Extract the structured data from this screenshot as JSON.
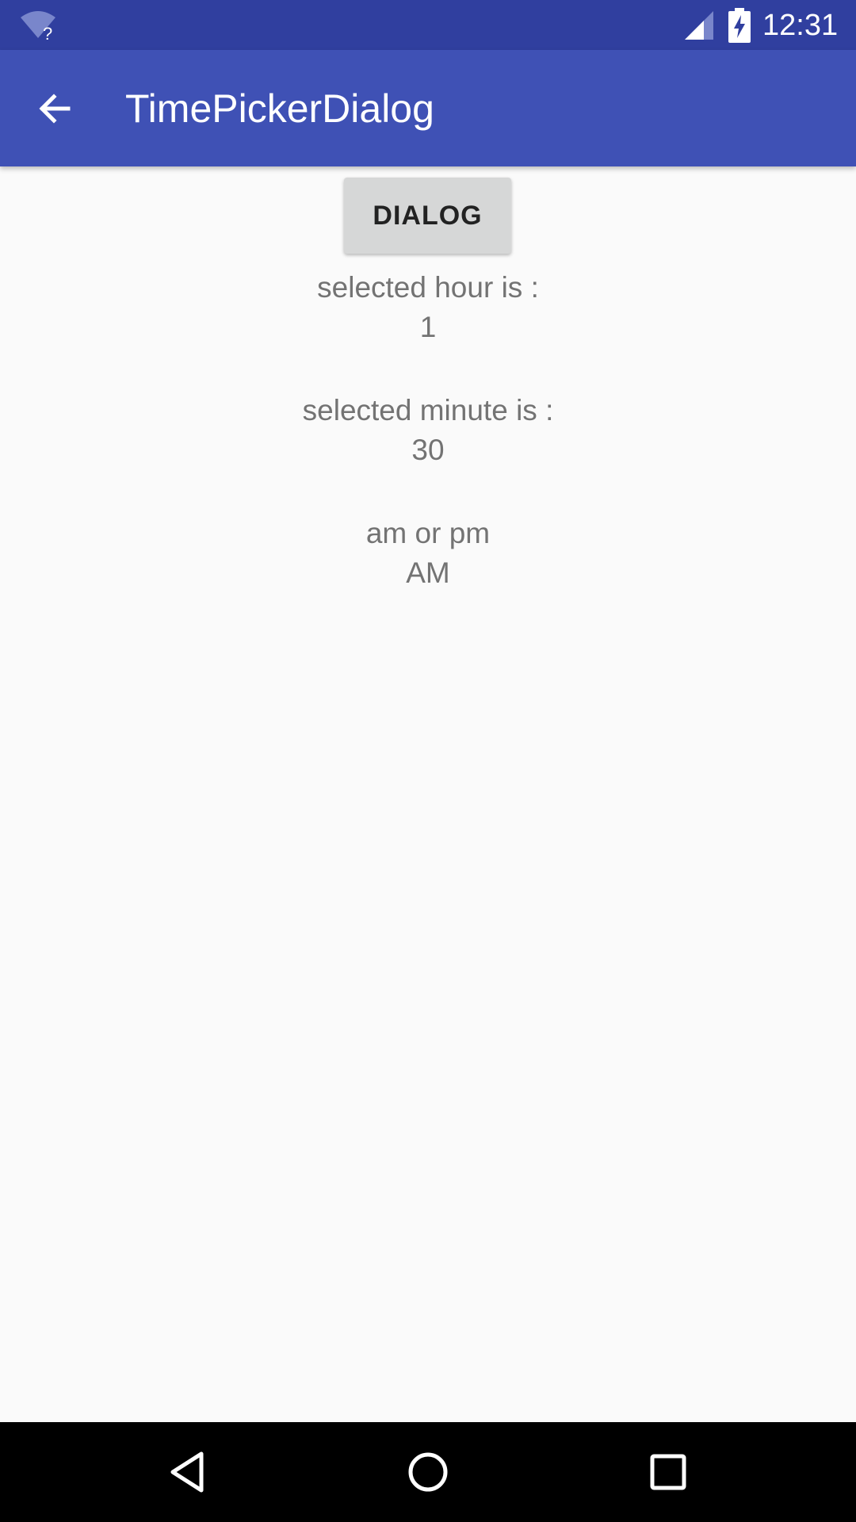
{
  "status_bar": {
    "time": "12:31",
    "icons": [
      "wifi-unknown-icon",
      "signal-icon",
      "battery-charging-icon"
    ]
  },
  "app_bar": {
    "title": "TimePickerDialog",
    "back_icon": "arrow-back-icon"
  },
  "main": {
    "dialog_button_label": "DIALOG",
    "hour_label": "selected hour is :",
    "hour_value": "1",
    "minute_label": "selected minute is :",
    "minute_value": "30",
    "ampm_label": "am or pm",
    "ampm_value": "AM"
  },
  "nav_bar": {
    "buttons": [
      "back-triangle-icon",
      "home-circle-icon",
      "recents-square-icon"
    ]
  },
  "colors": {
    "status_bar": "#303f9f",
    "app_bar": "#3f51b5",
    "background": "#fafafa",
    "button": "#d6d7d7",
    "text": "#737373"
  }
}
